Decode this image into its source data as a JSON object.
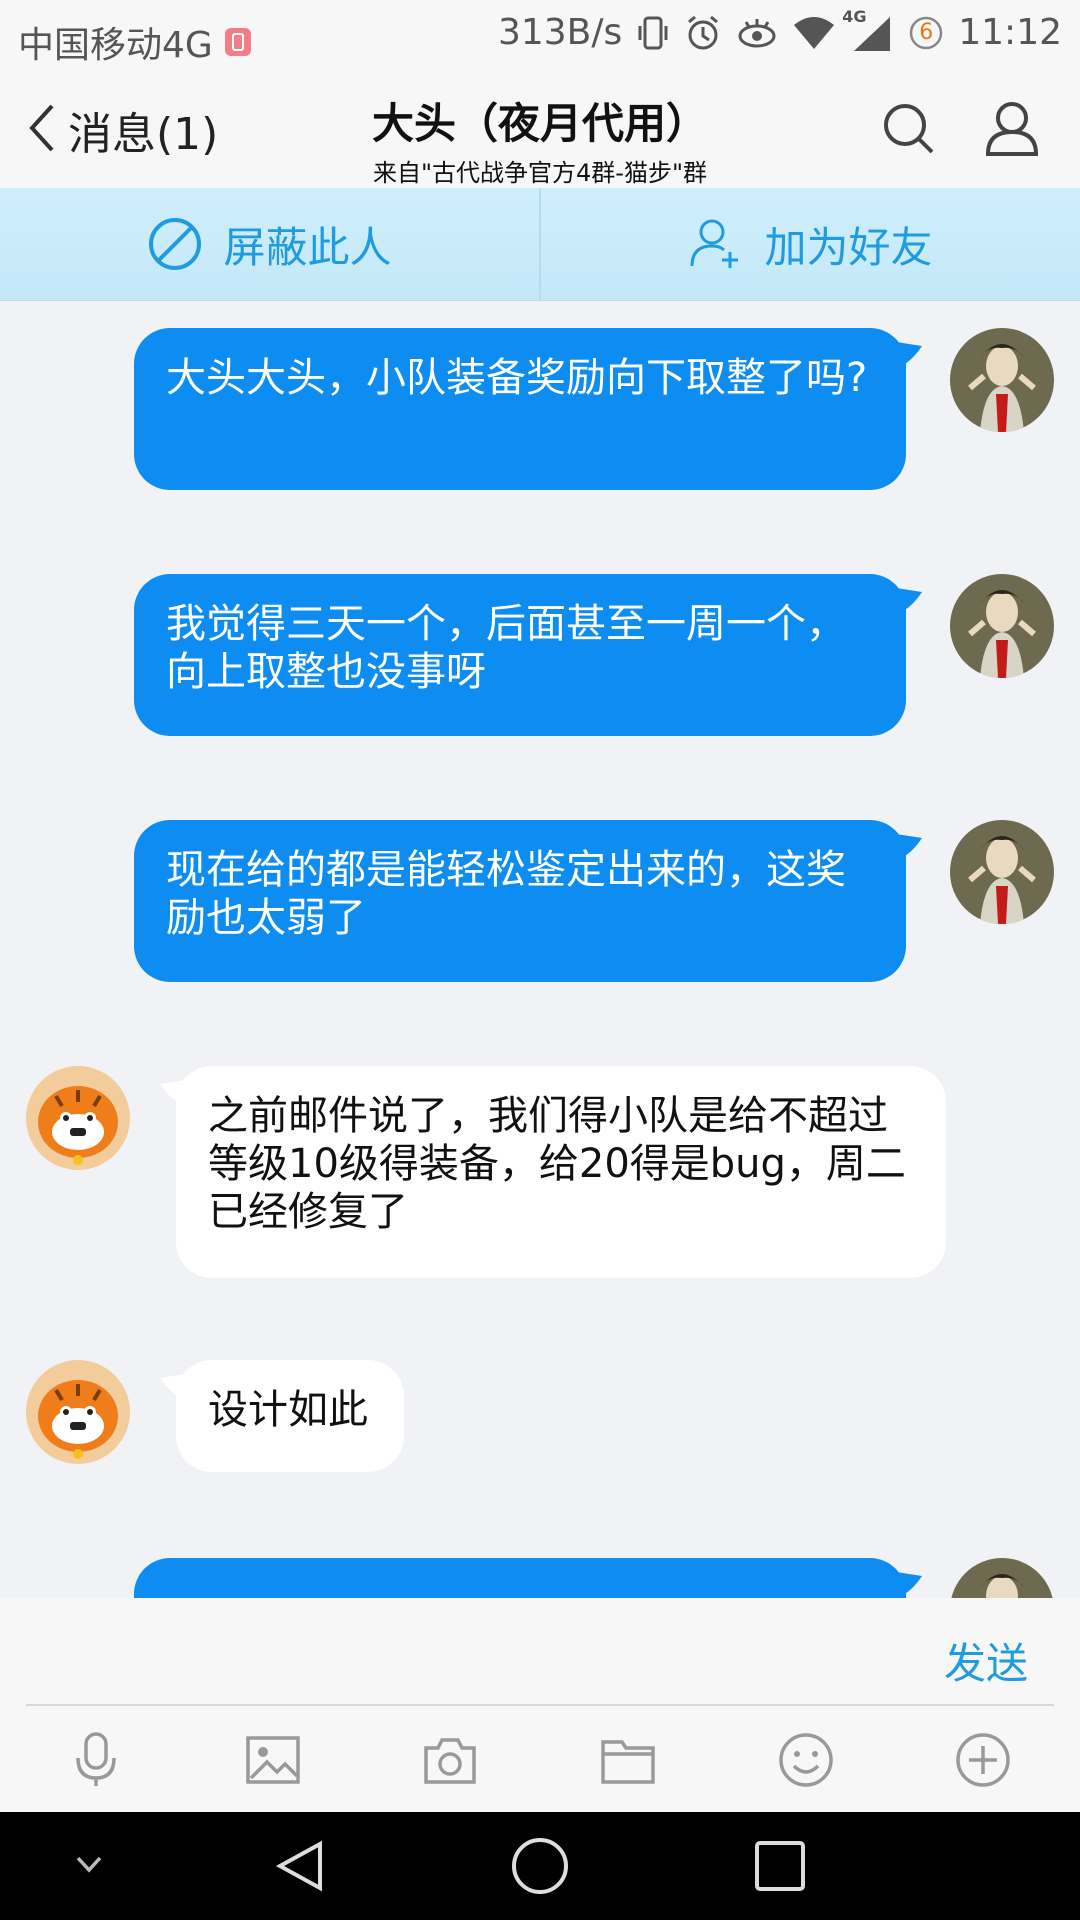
{
  "status_bar": {
    "carrier": "中国移动4G",
    "speed": "313B/s",
    "network": "4G",
    "notification_count": "6",
    "time": "11:12"
  },
  "nav": {
    "back_label": "消息(1)",
    "title": "大头（夜月代用）",
    "subtitle": "来自\"古代战争官方4群-猫步\"群"
  },
  "actions": {
    "block_label": "屏蔽此人",
    "add_friend_label": "加为好友"
  },
  "messages": [
    {
      "direction": "out",
      "text": "大头大头，小队装备奖励向下取整了吗?"
    },
    {
      "direction": "out",
      "text": "我觉得三天一个，后面甚至一周一个，向上取整也没事呀"
    },
    {
      "direction": "out",
      "text": "现在给的都是能轻松鉴定出来的，这奖励也太弱了"
    },
    {
      "direction": "in",
      "text": "之前邮件说了，我们得小队是给不超过等级10级得装备，给20得是bug，周二已经修复了"
    },
    {
      "direction": "in",
      "text": "设计如此"
    }
  ],
  "input": {
    "send_label": "发送"
  },
  "colors": {
    "accent": "#1f9be0",
    "outgoing_bubble": "#0d8cf2",
    "incoming_bubble": "#ffffff",
    "action_bar_bg": "#c9ebfa"
  }
}
